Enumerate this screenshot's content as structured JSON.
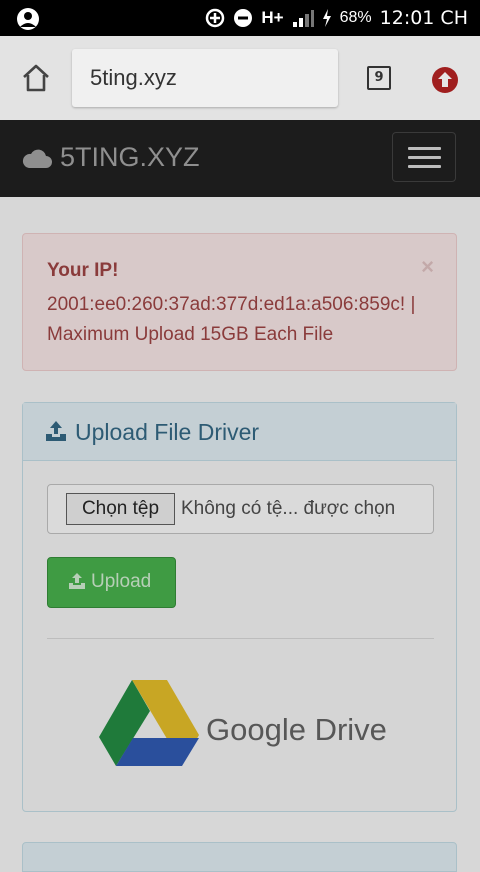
{
  "status_bar": {
    "network": "H+",
    "battery": "68%",
    "time": "12:01 CH"
  },
  "browser": {
    "url": "5ting.xyz",
    "tab_count": "9"
  },
  "navbar": {
    "brand": "5TING.XYZ"
  },
  "alert": {
    "title": "Your IP!",
    "body": "2001:ee0:260:37ad:377d:ed1a:a506:859c! | Maximum Upload 15GB Each File",
    "close": "×"
  },
  "panel": {
    "title": "Upload File Driver",
    "file_button": "Chọn tệp",
    "file_status": "Không có tệ... được chọn",
    "upload_label": "Upload",
    "logo_text": "Google Drive"
  },
  "colors": {
    "navbar_bg": "#1c1c1c",
    "alert_text": "#8a3b3b",
    "upload_green": "#3f9b43",
    "panel_title": "#2d5b74"
  }
}
